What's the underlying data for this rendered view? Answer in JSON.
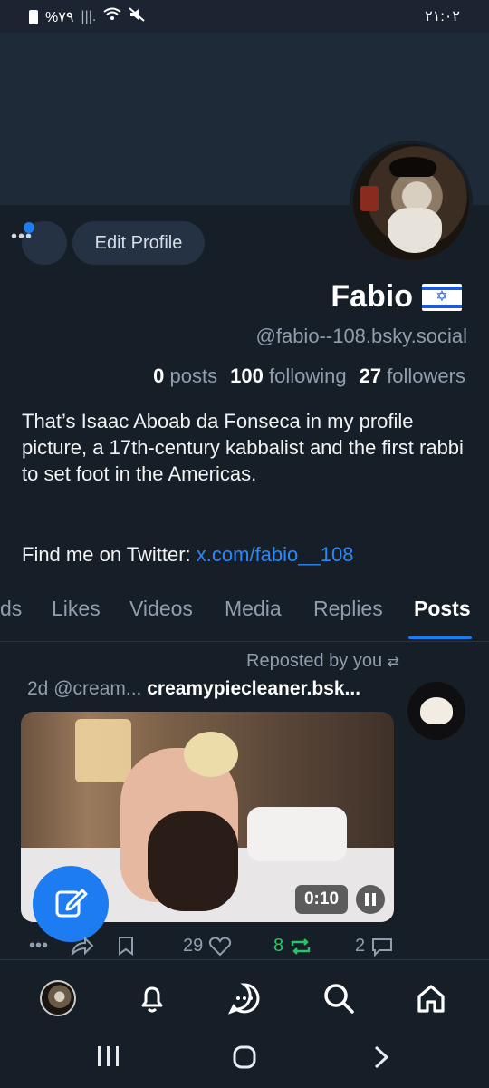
{
  "status_bar": {
    "battery": "%۷۹",
    "time": "۲۱:۰۲"
  },
  "profile": {
    "edit_label": "Edit Profile",
    "more_label": "•••",
    "name": "Fabio",
    "flag_icon": "israel-flag-icon",
    "handle": "@fabio--108.bsky.social",
    "stats": {
      "posts_count": "0",
      "posts_label": "posts",
      "following_count": "100",
      "following_label": "following",
      "followers_count": "27",
      "followers_label": "followers"
    },
    "bio": "That’s Isaac Aboab da Fonseca in my profile picture, a 17th-century kabbalist and the first rabbi to set foot in the Americas.",
    "twitter_prefix": "Find me on Twitter: ",
    "twitter_link": "x.com/fabio__108"
  },
  "tabs": [
    {
      "label": "ds"
    },
    {
      "label": "Likes"
    },
    {
      "label": "Videos"
    },
    {
      "label": "Media"
    },
    {
      "label": "Replies"
    },
    {
      "label": "Posts",
      "active": true
    }
  ],
  "post": {
    "repost_label": "Reposted by you",
    "age": "2d",
    "handle": "@cream...",
    "author": "creamypiecleaner.bsk...",
    "duration": "0:10",
    "replies": "2",
    "reposts": "8",
    "likes": "29"
  },
  "colors": {
    "accent": "#1e7cf2",
    "repost_active": "#27c468",
    "background": "#161e27"
  }
}
